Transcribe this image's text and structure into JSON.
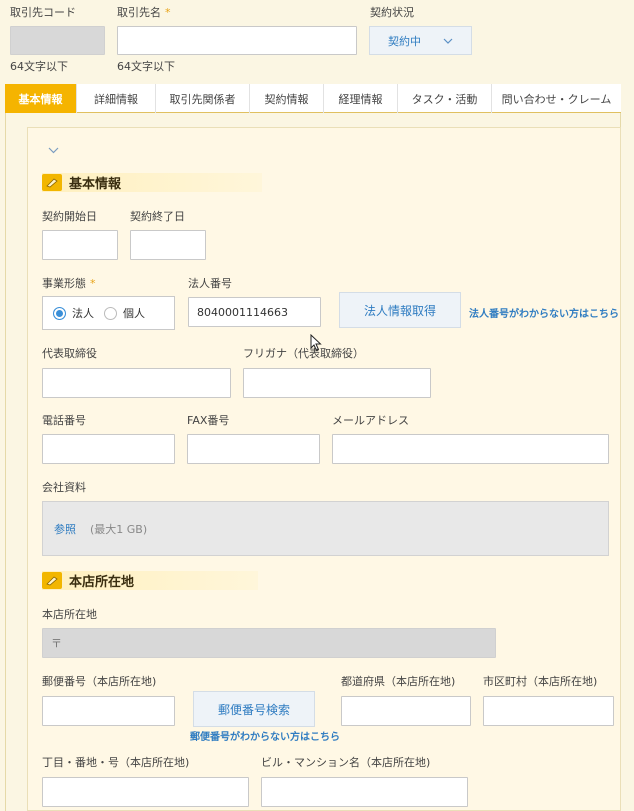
{
  "header": {
    "code_label": "取引先コード",
    "name_label": "取引先名",
    "name_required": "*",
    "status_label": "契約状況",
    "status_value": "契約中",
    "code_hint": "64文字以下",
    "name_hint": "64文字以下"
  },
  "tabs": [
    "基本情報",
    "詳細情報",
    "取引先関係者",
    "契約情報",
    "経理情報",
    "タスク・活動",
    "問い合わせ・クレーム"
  ],
  "active_tab": "基本情報",
  "basic": {
    "section_title": "基本情報",
    "contract_start_label": "契約開始日",
    "contract_end_label": "契約終了日",
    "business_type_label": "事業形態",
    "required_mark": "*",
    "radio_corporate": "法人",
    "radio_individual": "個人",
    "corp_number_label": "法人番号",
    "corp_number_value": "8040001114663",
    "corp_info_button": "法人情報取得",
    "corp_number_help": "法人番号がわからない方はこちら",
    "rep_label": "代表取締役",
    "furigana_label": "フリガナ（代表取締役）",
    "phone_label": "電話番号",
    "fax_label": "FAX番号",
    "email_label": "メールアドレス",
    "docs_label": "会社資料",
    "browse_link": "参照",
    "max_size": "(最大1 GB)"
  },
  "address": {
    "section_title": "本店所在地",
    "label": "本店所在地",
    "postal_mark": "〒",
    "postal_label": "郵便番号（本店所在地)",
    "postal_search_button": "郵便番号検索",
    "postal_help": "郵便番号がわからない方はこちら",
    "prefecture_label": "都道府県（本店所在地)",
    "city_label": "市区町村（本店所在地)",
    "street_label": "丁目・番地・号（本店所在地)",
    "building_label": "ビル・マンション名（本店所在地)"
  },
  "colors": {
    "accent": "#f5b400",
    "link": "#2f7cc1",
    "background": "#fbf6e3"
  }
}
